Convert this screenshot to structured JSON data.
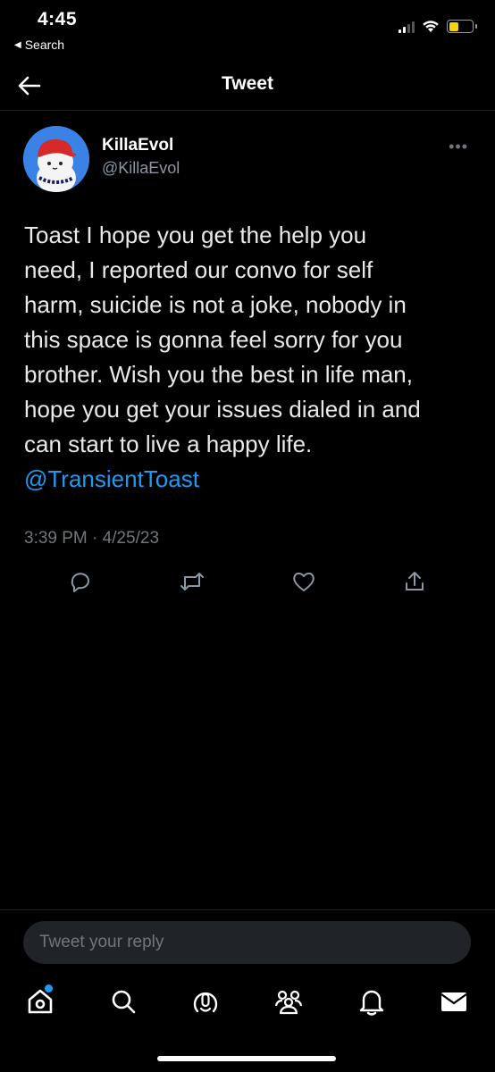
{
  "status_bar": {
    "time": "4:45",
    "back_app": "Search"
  },
  "header": {
    "title": "Tweet"
  },
  "tweet": {
    "display_name": "KillaEvol",
    "handle": "@KillaEvol",
    "text_lines": [
      "Toast I hope you get the help you",
      "need, I reported our convo for self",
      "harm, suicide is not a joke, nobody in",
      "this space is gonna feel sorry for you",
      "brother. Wish you the best in life man,",
      "hope you get your issues dialed in and",
      "can start to live a happy life."
    ],
    "mention": "@TransientToast",
    "timestamp": "3:39 PM · 4/25/23",
    "actions": [
      "reply-icon",
      "retweet-icon",
      "like-icon",
      "share-icon"
    ]
  },
  "reply": {
    "placeholder": "Tweet your reply"
  },
  "bottom_nav": {
    "items": [
      "home-icon",
      "search-icon",
      "spaces-icon",
      "communities-icon",
      "notifications-icon",
      "messages-icon"
    ]
  },
  "colors": {
    "background": "#000000",
    "accent": "#1d9bf0",
    "secondary_text": "#71767b",
    "battery": "#f5d20a"
  }
}
